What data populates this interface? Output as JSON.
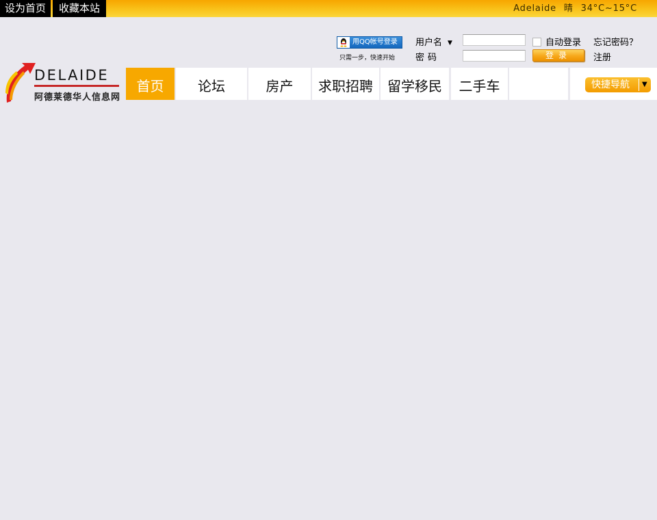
{
  "topbar": {
    "set_home": "设为首页",
    "bookmark": "收藏本站",
    "weather": {
      "city": "Adelaide",
      "condition": "晴",
      "temp": "34°C~15°C"
    }
  },
  "login": {
    "qq_button": "用QQ帐号登录",
    "qq_sub": "只需一步，快速开始",
    "username_label": "用户名",
    "password_label": "密码",
    "username_value": "",
    "password_value": "",
    "auto_login": "自动登录",
    "forgot": "忘记密码？",
    "login_button": "登录",
    "register": "注册"
  },
  "logo": {
    "word": "DELAIDE",
    "subtitle": "阿德莱德华人信息网"
  },
  "nav": {
    "items": [
      {
        "label": "首页",
        "active": true
      },
      {
        "label": "论坛"
      },
      {
        "label": "房产"
      },
      {
        "label": "求职招聘"
      },
      {
        "label": "留学移民"
      },
      {
        "label": "二手车"
      },
      {
        "label": ""
      },
      {
        "label": ""
      }
    ],
    "quick_nav": "快捷导航"
  },
  "colors": {
    "accent": "#f7a800",
    "background": "#e9e8ee",
    "logo_red": "#c62828"
  }
}
